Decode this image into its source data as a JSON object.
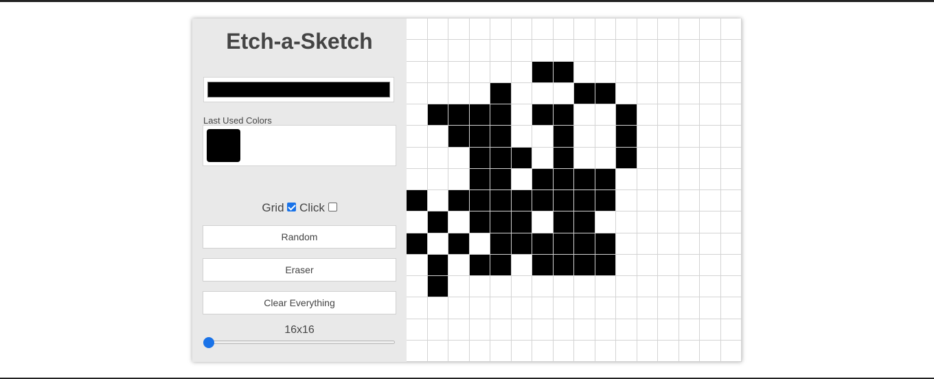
{
  "app": {
    "title": "Etch-a-Sketch"
  },
  "color_picker": {
    "value": "#000000"
  },
  "last_used": {
    "label": "Last Used Colors",
    "colors": [
      "#000000"
    ]
  },
  "toggles": {
    "grid_label": "Grid",
    "grid_checked": true,
    "click_label": "Click",
    "click_checked": false
  },
  "buttons": {
    "random": "Random",
    "eraser": "Eraser",
    "clear": "Clear Everything"
  },
  "size": {
    "label": "16x16",
    "value": 16
  },
  "canvas": {
    "rows": 16,
    "cols": 16,
    "ink_color": "#000000",
    "filled_rows": [
      "................",
      "................",
      "......XX........",
      "....X...XX......",
      ".XXXX.XX..X.....",
      "..XXX..X..X.....",
      "...XXX.X..X.....",
      "...XX.XXXX......",
      "X.XXXXXXXX......",
      ".X.XXX.XX.......",
      "X.X.XXXXXX......",
      ".X.XX.XXXX......",
      ".X..............",
      "................",
      "................",
      "................"
    ]
  }
}
